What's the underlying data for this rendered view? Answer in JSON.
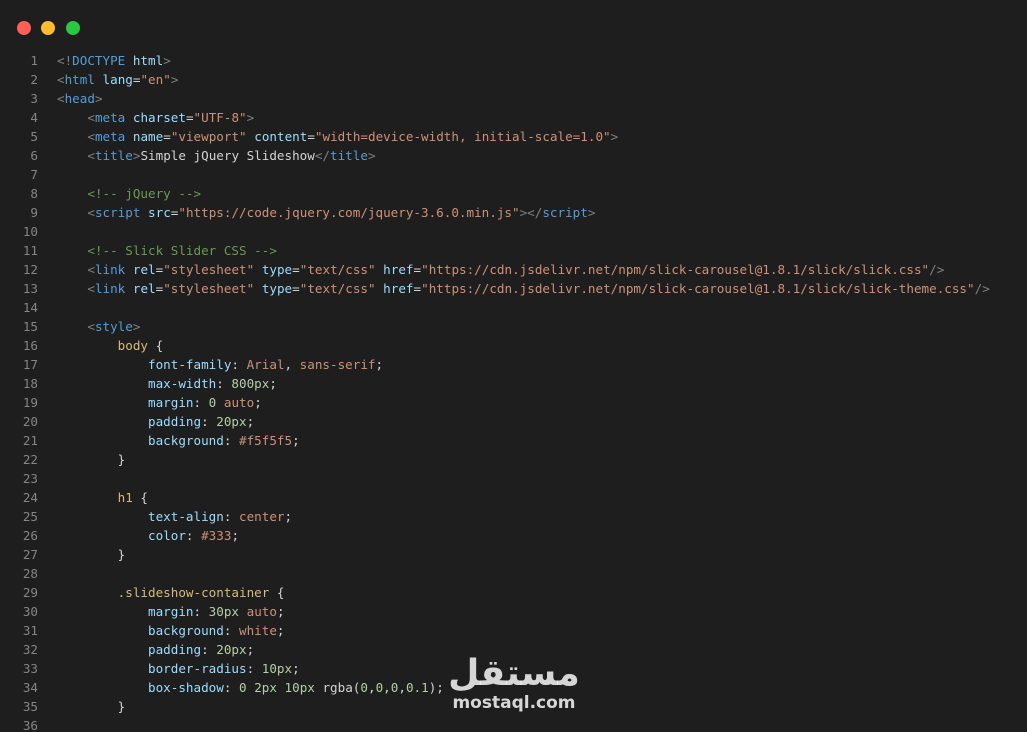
{
  "window": {
    "controls": [
      "close",
      "minimize",
      "maximize"
    ],
    "colors": {
      "close": "#ff5f57",
      "minimize": "#febc2e",
      "maximize": "#28c840",
      "background": "#1e1e1e"
    }
  },
  "editor": {
    "lines": [
      {
        "n": "1",
        "tokens": [
          [
            "c-bracket",
            "<!"
          ],
          [
            "c-tag",
            "DOCTYPE"
          ],
          [
            "c-text",
            " "
          ],
          [
            "c-attr",
            "html"
          ],
          [
            "c-bracket",
            ">"
          ]
        ]
      },
      {
        "n": "2",
        "tokens": [
          [
            "c-bracket",
            "<"
          ],
          [
            "c-tag",
            "html"
          ],
          [
            "c-text",
            " "
          ],
          [
            "c-attr",
            "lang"
          ],
          [
            "c-punc",
            "="
          ],
          [
            "c-str",
            "\"en\""
          ],
          [
            "c-bracket",
            ">"
          ]
        ]
      },
      {
        "n": "3",
        "tokens": [
          [
            "c-bracket",
            "<"
          ],
          [
            "c-tag",
            "head"
          ],
          [
            "c-bracket",
            ">"
          ]
        ]
      },
      {
        "n": "4",
        "tokens": [
          [
            "c-text",
            "    "
          ],
          [
            "c-bracket",
            "<"
          ],
          [
            "c-tag",
            "meta"
          ],
          [
            "c-text",
            " "
          ],
          [
            "c-attr",
            "charset"
          ],
          [
            "c-punc",
            "="
          ],
          [
            "c-str",
            "\"UTF-8\""
          ],
          [
            "c-bracket",
            ">"
          ]
        ]
      },
      {
        "n": "5",
        "tokens": [
          [
            "c-text",
            "    "
          ],
          [
            "c-bracket",
            "<"
          ],
          [
            "c-tag",
            "meta"
          ],
          [
            "c-text",
            " "
          ],
          [
            "c-attr",
            "name"
          ],
          [
            "c-punc",
            "="
          ],
          [
            "c-str",
            "\"viewport\""
          ],
          [
            "c-text",
            " "
          ],
          [
            "c-attr",
            "content"
          ],
          [
            "c-punc",
            "="
          ],
          [
            "c-str",
            "\"width=device-width, initial-scale=1.0\""
          ],
          [
            "c-bracket",
            ">"
          ]
        ]
      },
      {
        "n": "6",
        "tokens": [
          [
            "c-text",
            "    "
          ],
          [
            "c-bracket",
            "<"
          ],
          [
            "c-tag",
            "title"
          ],
          [
            "c-bracket",
            ">"
          ],
          [
            "c-text",
            "Simple jQuery Slideshow"
          ],
          [
            "c-bracket",
            "</"
          ],
          [
            "c-tag",
            "title"
          ],
          [
            "c-bracket",
            ">"
          ]
        ]
      },
      {
        "n": "7",
        "tokens": []
      },
      {
        "n": "8",
        "tokens": [
          [
            "c-text",
            "    "
          ],
          [
            "c-comment",
            "<!-- jQuery -->"
          ]
        ]
      },
      {
        "n": "9",
        "tokens": [
          [
            "c-text",
            "    "
          ],
          [
            "c-bracket",
            "<"
          ],
          [
            "c-tag",
            "script"
          ],
          [
            "c-text",
            " "
          ],
          [
            "c-attr",
            "src"
          ],
          [
            "c-punc",
            "="
          ],
          [
            "c-str",
            "\"https://code.jquery.com/jquery-3.6.0.min.js\""
          ],
          [
            "c-bracket",
            "></"
          ],
          [
            "c-tag",
            "script"
          ],
          [
            "c-bracket",
            ">"
          ]
        ]
      },
      {
        "n": "10",
        "tokens": []
      },
      {
        "n": "11",
        "tokens": [
          [
            "c-text",
            "    "
          ],
          [
            "c-comment",
            "<!-- Slick Slider CSS -->"
          ]
        ]
      },
      {
        "n": "12",
        "tokens": [
          [
            "c-text",
            "    "
          ],
          [
            "c-bracket",
            "<"
          ],
          [
            "c-tag",
            "link"
          ],
          [
            "c-text",
            " "
          ],
          [
            "c-attr",
            "rel"
          ],
          [
            "c-punc",
            "="
          ],
          [
            "c-str",
            "\"stylesheet\""
          ],
          [
            "c-text",
            " "
          ],
          [
            "c-attr",
            "type"
          ],
          [
            "c-punc",
            "="
          ],
          [
            "c-str",
            "\"text/css\""
          ],
          [
            "c-text",
            " "
          ],
          [
            "c-attr",
            "href"
          ],
          [
            "c-punc",
            "="
          ],
          [
            "c-str",
            "\"https://cdn.jsdelivr.net/npm/slick-carousel@1.8.1/slick/slick.css\""
          ],
          [
            "c-bracket",
            "/>"
          ]
        ]
      },
      {
        "n": "13",
        "tokens": [
          [
            "c-text",
            "    "
          ],
          [
            "c-bracket",
            "<"
          ],
          [
            "c-tag",
            "link"
          ],
          [
            "c-text",
            " "
          ],
          [
            "c-attr",
            "rel"
          ],
          [
            "c-punc",
            "="
          ],
          [
            "c-str",
            "\"stylesheet\""
          ],
          [
            "c-text",
            " "
          ],
          [
            "c-attr",
            "type"
          ],
          [
            "c-punc",
            "="
          ],
          [
            "c-str",
            "\"text/css\""
          ],
          [
            "c-text",
            " "
          ],
          [
            "c-attr",
            "href"
          ],
          [
            "c-punc",
            "="
          ],
          [
            "c-str",
            "\"https://cdn.jsdelivr.net/npm/slick-carousel@1.8.1/slick/slick-theme.css\""
          ],
          [
            "c-bracket",
            "/>"
          ]
        ]
      },
      {
        "n": "14",
        "tokens": []
      },
      {
        "n": "15",
        "tokens": [
          [
            "c-text",
            "    "
          ],
          [
            "c-bracket",
            "<"
          ],
          [
            "c-tag",
            "style"
          ],
          [
            "c-bracket",
            ">"
          ]
        ]
      },
      {
        "n": "16",
        "tokens": [
          [
            "c-text",
            "        "
          ],
          [
            "c-sel",
            "body"
          ],
          [
            "c-punc",
            " {"
          ]
        ]
      },
      {
        "n": "17",
        "tokens": [
          [
            "c-text",
            "            "
          ],
          [
            "c-prop",
            "font-family"
          ],
          [
            "c-punc",
            ": "
          ],
          [
            "c-val",
            "Arial"
          ],
          [
            "c-punc",
            ", "
          ],
          [
            "c-val",
            "sans-serif"
          ],
          [
            "c-punc",
            ";"
          ]
        ]
      },
      {
        "n": "18",
        "tokens": [
          [
            "c-text",
            "            "
          ],
          [
            "c-prop",
            "max-width"
          ],
          [
            "c-punc",
            ": "
          ],
          [
            "c-num",
            "800px"
          ],
          [
            "c-punc",
            ";"
          ]
        ]
      },
      {
        "n": "19",
        "tokens": [
          [
            "c-text",
            "            "
          ],
          [
            "c-prop",
            "margin"
          ],
          [
            "c-punc",
            ": "
          ],
          [
            "c-num",
            "0"
          ],
          [
            "c-punc",
            " "
          ],
          [
            "c-val",
            "auto"
          ],
          [
            "c-punc",
            ";"
          ]
        ]
      },
      {
        "n": "20",
        "tokens": [
          [
            "c-text",
            "            "
          ],
          [
            "c-prop",
            "padding"
          ],
          [
            "c-punc",
            ": "
          ],
          [
            "c-num",
            "20px"
          ],
          [
            "c-punc",
            ";"
          ]
        ]
      },
      {
        "n": "21",
        "tokens": [
          [
            "c-text",
            "            "
          ],
          [
            "c-prop",
            "background"
          ],
          [
            "c-punc",
            ": "
          ],
          [
            "c-val",
            "#f5f5f5"
          ],
          [
            "c-punc",
            ";"
          ]
        ]
      },
      {
        "n": "22",
        "tokens": [
          [
            "c-text",
            "        "
          ],
          [
            "c-punc",
            "}"
          ]
        ]
      },
      {
        "n": "23",
        "tokens": []
      },
      {
        "n": "24",
        "tokens": [
          [
            "c-text",
            "        "
          ],
          [
            "c-sel",
            "h1"
          ],
          [
            "c-punc",
            " {"
          ]
        ]
      },
      {
        "n": "25",
        "tokens": [
          [
            "c-text",
            "            "
          ],
          [
            "c-prop",
            "text-align"
          ],
          [
            "c-punc",
            ": "
          ],
          [
            "c-val",
            "center"
          ],
          [
            "c-punc",
            ";"
          ]
        ]
      },
      {
        "n": "26",
        "tokens": [
          [
            "c-text",
            "            "
          ],
          [
            "c-prop",
            "color"
          ],
          [
            "c-punc",
            ": "
          ],
          [
            "c-val",
            "#333"
          ],
          [
            "c-punc",
            ";"
          ]
        ]
      },
      {
        "n": "27",
        "tokens": [
          [
            "c-text",
            "        "
          ],
          [
            "c-punc",
            "}"
          ]
        ]
      },
      {
        "n": "28",
        "tokens": []
      },
      {
        "n": "29",
        "tokens": [
          [
            "c-text",
            "        "
          ],
          [
            "c-sel",
            ".slideshow-container"
          ],
          [
            "c-punc",
            " {"
          ]
        ]
      },
      {
        "n": "30",
        "tokens": [
          [
            "c-text",
            "            "
          ],
          [
            "c-prop",
            "margin"
          ],
          [
            "c-punc",
            ": "
          ],
          [
            "c-num",
            "30px"
          ],
          [
            "c-punc",
            " "
          ],
          [
            "c-val",
            "auto"
          ],
          [
            "c-punc",
            ";"
          ]
        ]
      },
      {
        "n": "31",
        "tokens": [
          [
            "c-text",
            "            "
          ],
          [
            "c-prop",
            "background"
          ],
          [
            "c-punc",
            ": "
          ],
          [
            "c-val",
            "white"
          ],
          [
            "c-punc",
            ";"
          ]
        ]
      },
      {
        "n": "32",
        "tokens": [
          [
            "c-text",
            "            "
          ],
          [
            "c-prop",
            "padding"
          ],
          [
            "c-punc",
            ": "
          ],
          [
            "c-num",
            "20px"
          ],
          [
            "c-punc",
            ";"
          ]
        ]
      },
      {
        "n": "33",
        "tokens": [
          [
            "c-text",
            "            "
          ],
          [
            "c-prop",
            "border-radius"
          ],
          [
            "c-punc",
            ": "
          ],
          [
            "c-num",
            "10px"
          ],
          [
            "c-punc",
            ";"
          ]
        ]
      },
      {
        "n": "34",
        "tokens": [
          [
            "c-text",
            "            "
          ],
          [
            "c-prop",
            "box-shadow"
          ],
          [
            "c-punc",
            ": "
          ],
          [
            "c-num",
            "0"
          ],
          [
            "c-punc",
            " "
          ],
          [
            "c-num",
            "2px"
          ],
          [
            "c-punc",
            " "
          ],
          [
            "c-num",
            "10px"
          ],
          [
            "c-punc",
            " rgba("
          ],
          [
            "c-num",
            "0"
          ],
          [
            "c-punc",
            ","
          ],
          [
            "c-num",
            "0"
          ],
          [
            "c-punc",
            ","
          ],
          [
            "c-num",
            "0"
          ],
          [
            "c-punc",
            ","
          ],
          [
            "c-num",
            "0.1"
          ],
          [
            "c-punc",
            ");"
          ]
        ]
      },
      {
        "n": "35",
        "tokens": [
          [
            "c-text",
            "        "
          ],
          [
            "c-punc",
            "}"
          ]
        ]
      },
      {
        "n": "36",
        "tokens": []
      }
    ]
  },
  "watermark": {
    "arabic": "مستقل",
    "latin": "mostaql.com"
  }
}
